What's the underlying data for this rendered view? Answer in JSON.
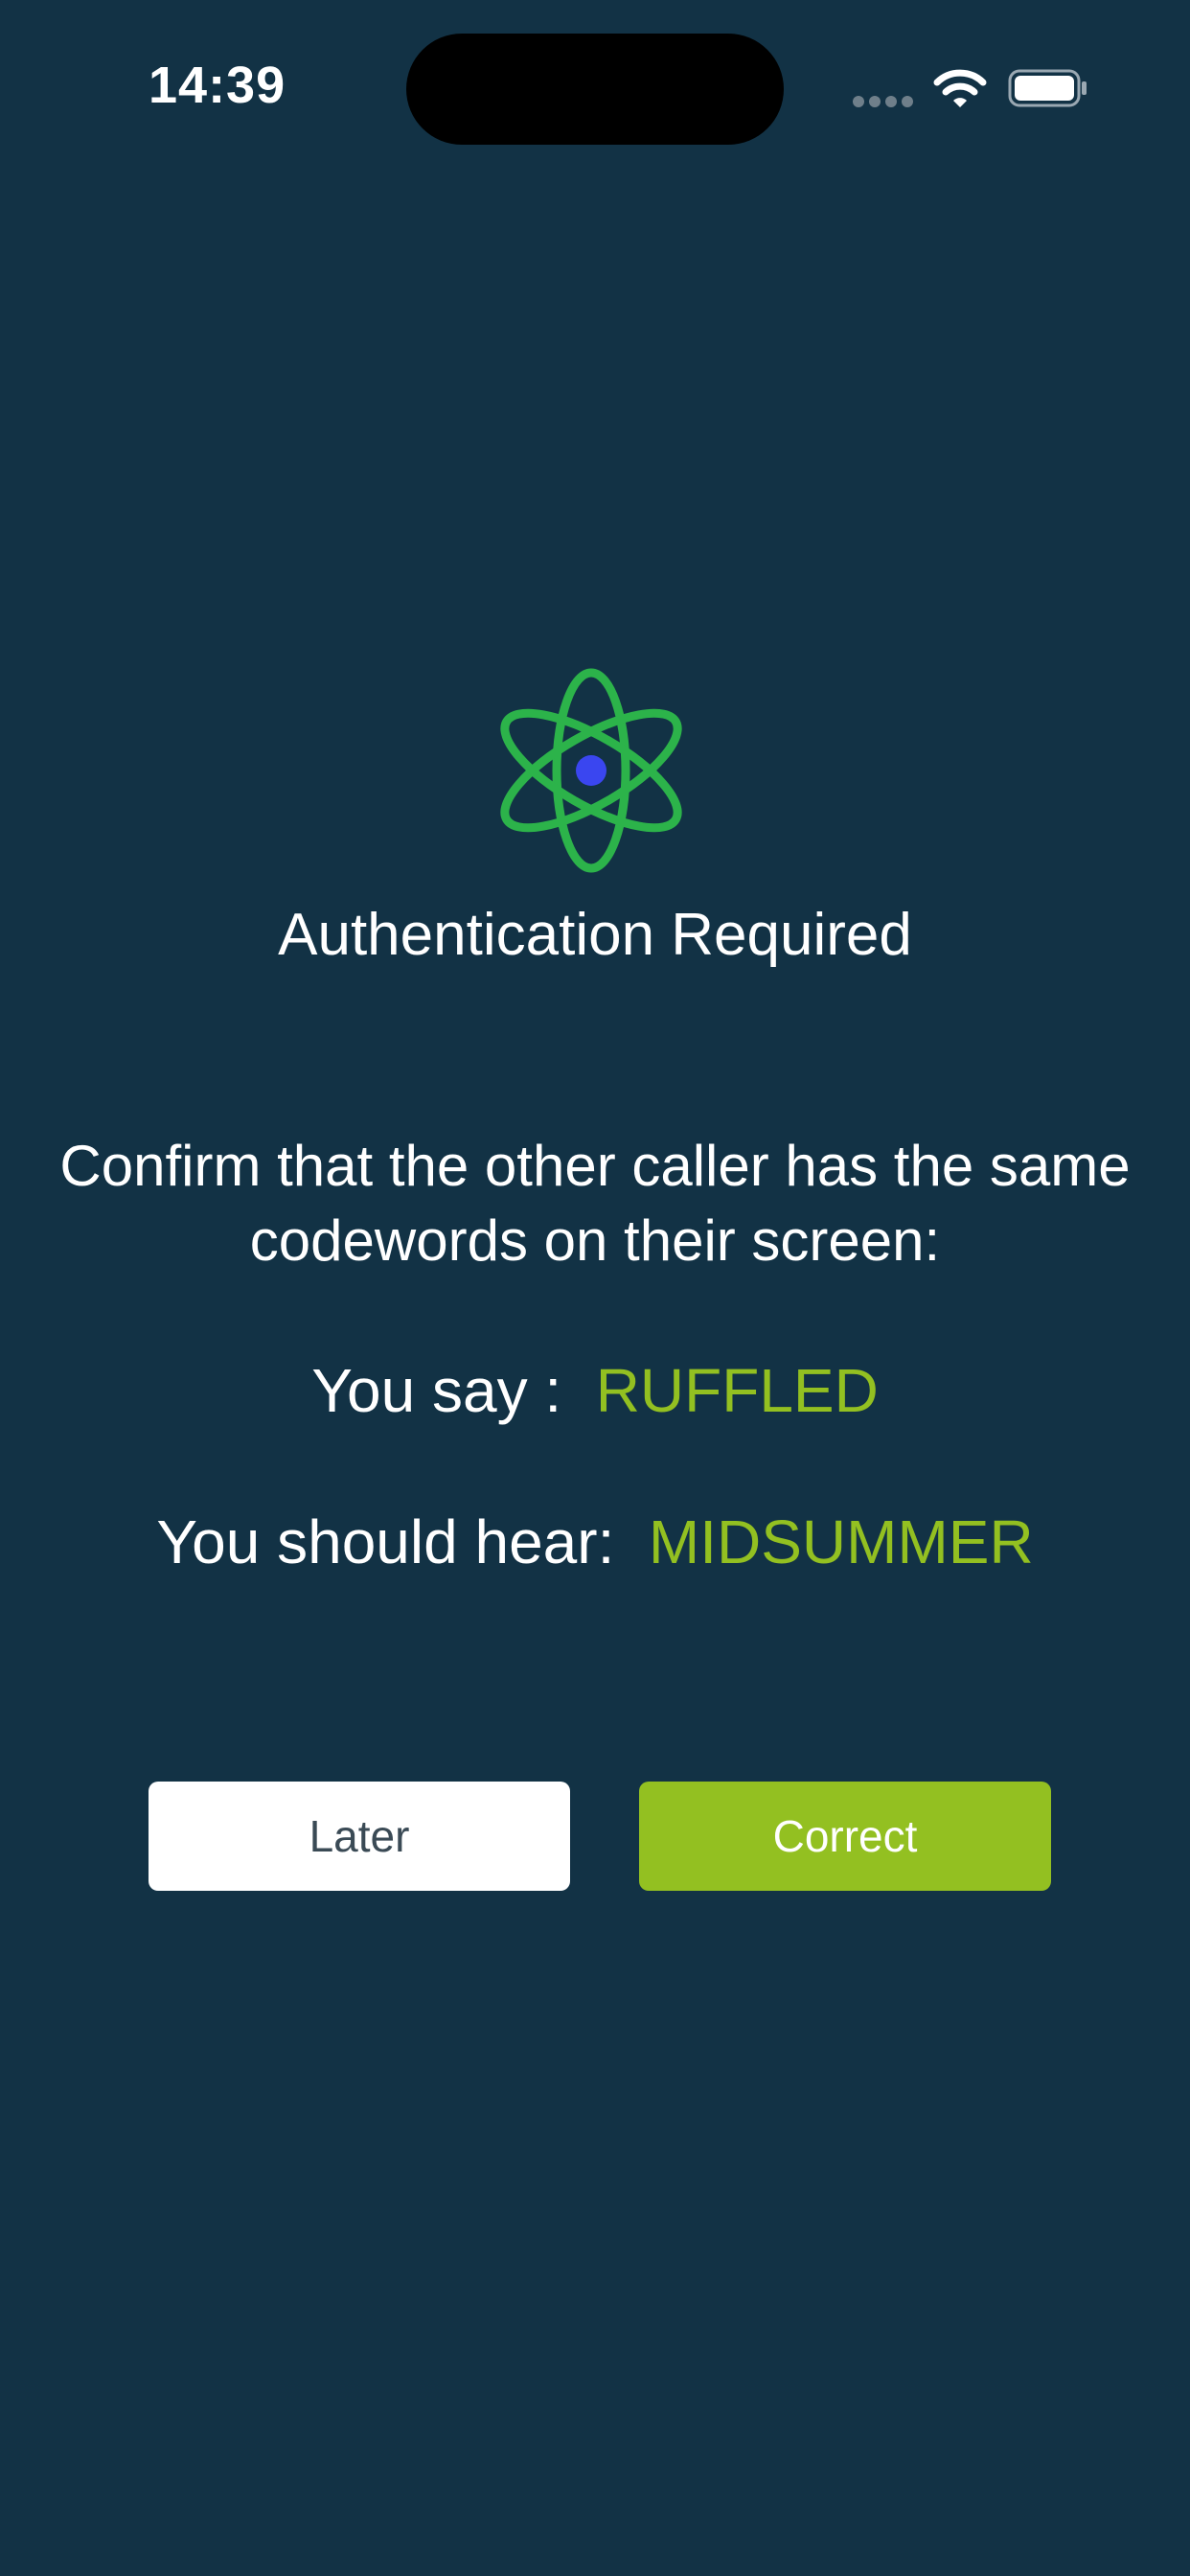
{
  "status_bar": {
    "time": "14:39",
    "icons": [
      "signal-dots-icon",
      "wifi-icon",
      "battery-icon"
    ]
  },
  "auth": {
    "icon": "atom-icon",
    "title": "Authentication Required",
    "instruction": "Confirm that the other caller has the same codewords on their screen:",
    "say_label": "You say :",
    "say_word": "RUFFLED",
    "hear_label": "You should hear:",
    "hear_word": "MIDSUMMER"
  },
  "buttons": {
    "later_label": "Later",
    "correct_label": "Correct"
  },
  "colors": {
    "background": "#123245",
    "accent_green": "#93c021",
    "atom_green": "#2cb34a",
    "atom_nucleus": "#3a46f0",
    "button_white": "#ffffff"
  }
}
